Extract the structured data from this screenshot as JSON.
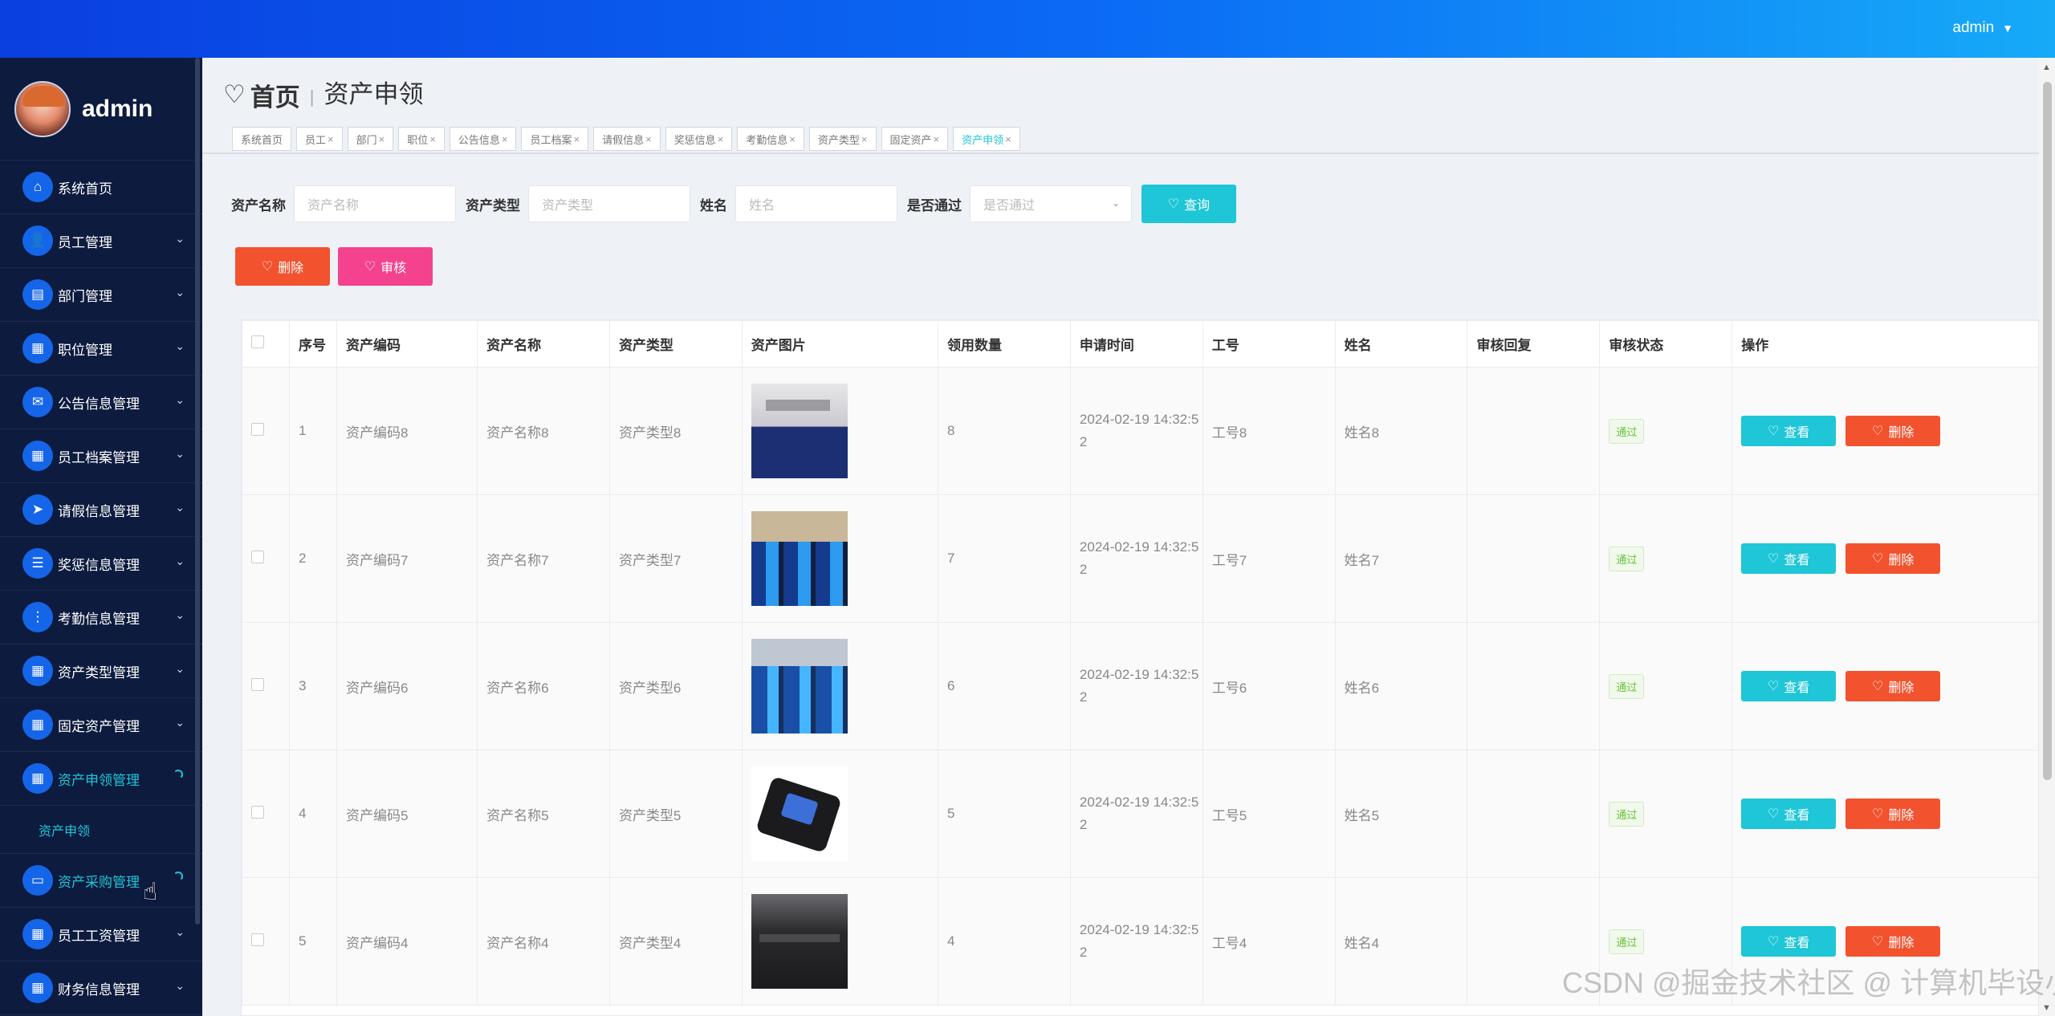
{
  "header": {
    "username": "admin",
    "caret": "▼"
  },
  "sidebar": {
    "profile_name": "admin",
    "items": [
      {
        "label": "系统首页",
        "icon": "home-icon",
        "glyph": "⌂"
      },
      {
        "label": "员工管理",
        "icon": "user-icon",
        "glyph": "👤"
      },
      {
        "label": "部门管理",
        "icon": "clipboard-icon",
        "glyph": "▤"
      },
      {
        "label": "职位管理",
        "icon": "grid-icon",
        "glyph": "▦"
      },
      {
        "label": "公告信息管理",
        "icon": "ticket-icon",
        "glyph": "✉"
      },
      {
        "label": "员工档案管理",
        "icon": "grid-icon",
        "glyph": "▦"
      },
      {
        "label": "请假信息管理",
        "icon": "send-icon",
        "glyph": "➤"
      },
      {
        "label": "奖惩信息管理",
        "icon": "list-icon",
        "glyph": "☰"
      },
      {
        "label": "考勤信息管理",
        "icon": "apps-icon",
        "glyph": "⋮"
      },
      {
        "label": "资产类型管理",
        "icon": "grid-icon",
        "glyph": "▦"
      },
      {
        "label": "固定资产管理",
        "icon": "grid-icon",
        "glyph": "▦"
      },
      {
        "label": "资产申领管理",
        "icon": "grid-icon",
        "glyph": "▦"
      },
      {
        "label": "资产采购管理",
        "icon": "monitor-icon",
        "glyph": "▭"
      },
      {
        "label": "员工工资管理",
        "icon": "grid-icon",
        "glyph": "▦"
      },
      {
        "label": "财务信息管理",
        "icon": "grid-icon",
        "glyph": "▦"
      }
    ],
    "sub_item": "资产申领",
    "chevron": "⌄"
  },
  "breadcrumb": {
    "home": "首页",
    "separator": "|",
    "current": "资产申领"
  },
  "tabs": [
    {
      "label": "系统首页",
      "close": ""
    },
    {
      "label": "员工",
      "close": "×"
    },
    {
      "label": "部门",
      "close": "×"
    },
    {
      "label": "职位",
      "close": "×"
    },
    {
      "label": "公告信息",
      "close": "×"
    },
    {
      "label": "员工档案",
      "close": "×"
    },
    {
      "label": "请假信息",
      "close": "×"
    },
    {
      "label": "奖惩信息",
      "close": "×"
    },
    {
      "label": "考勤信息",
      "close": "×"
    },
    {
      "label": "资产类型",
      "close": "×"
    },
    {
      "label": "固定资产",
      "close": "×"
    },
    {
      "label": "资产申领",
      "close": "×"
    }
  ],
  "search": {
    "asset_name_label": "资产名称",
    "asset_name_placeholder": "资产名称",
    "asset_type_label": "资产类型",
    "asset_type_placeholder": "资产类型",
    "name_label": "姓名",
    "name_placeholder": "姓名",
    "passed_label": "是否通过",
    "passed_placeholder": "是否通过",
    "button": "查询"
  },
  "actions": {
    "delete": "删除",
    "audit": "审核"
  },
  "table": {
    "headers": [
      "",
      "序号",
      "资产编码",
      "资产名称",
      "资产类型",
      "资产图片",
      "领用数量",
      "申请时间",
      "工号",
      "姓名",
      "审核回复",
      "审核状态",
      "操作"
    ],
    "rows": [
      {
        "index": "1",
        "code": "资产编码8",
        "name": "资产名称8",
        "type": "资产类型8",
        "qty": "8",
        "time": "2024-02-19 14:32:52",
        "no": "工号8",
        "person": "姓名8",
        "reply": "",
        "status": "通过"
      },
      {
        "index": "2",
        "code": "资产编码7",
        "name": "资产名称7",
        "type": "资产类型7",
        "qty": "7",
        "time": "2024-02-19 14:32:52",
        "no": "工号7",
        "person": "姓名7",
        "reply": "",
        "status": "通过"
      },
      {
        "index": "3",
        "code": "资产编码6",
        "name": "资产名称6",
        "type": "资产类型6",
        "qty": "6",
        "time": "2024-02-19 14:32:52",
        "no": "工号6",
        "person": "姓名6",
        "reply": "",
        "status": "通过"
      },
      {
        "index": "4",
        "code": "资产编码5",
        "name": "资产名称5",
        "type": "资产类型5",
        "qty": "5",
        "time": "2024-02-19 14:32:52",
        "no": "工号5",
        "person": "姓名5",
        "reply": "",
        "status": "通过"
      },
      {
        "index": "5",
        "code": "资产编码4",
        "name": "资产名称4",
        "type": "资产类型4",
        "qty": "4",
        "time": "2024-02-19 14:32:52",
        "no": "工号4",
        "person": "姓名4",
        "reply": "",
        "status": "通过"
      }
    ],
    "view_label": "查看",
    "delete_label": "删除"
  },
  "watermark": {
    "text": "CSDN @掘金技术社区 @ 计算机毕设小月哥"
  },
  "colors": {
    "topbar": "#0b6cf5",
    "sidebar": "#0d1b3e",
    "accent": "#1ec6d7",
    "danger": "#f2522e",
    "pink": "#f4428e",
    "success": "#67c23a"
  }
}
